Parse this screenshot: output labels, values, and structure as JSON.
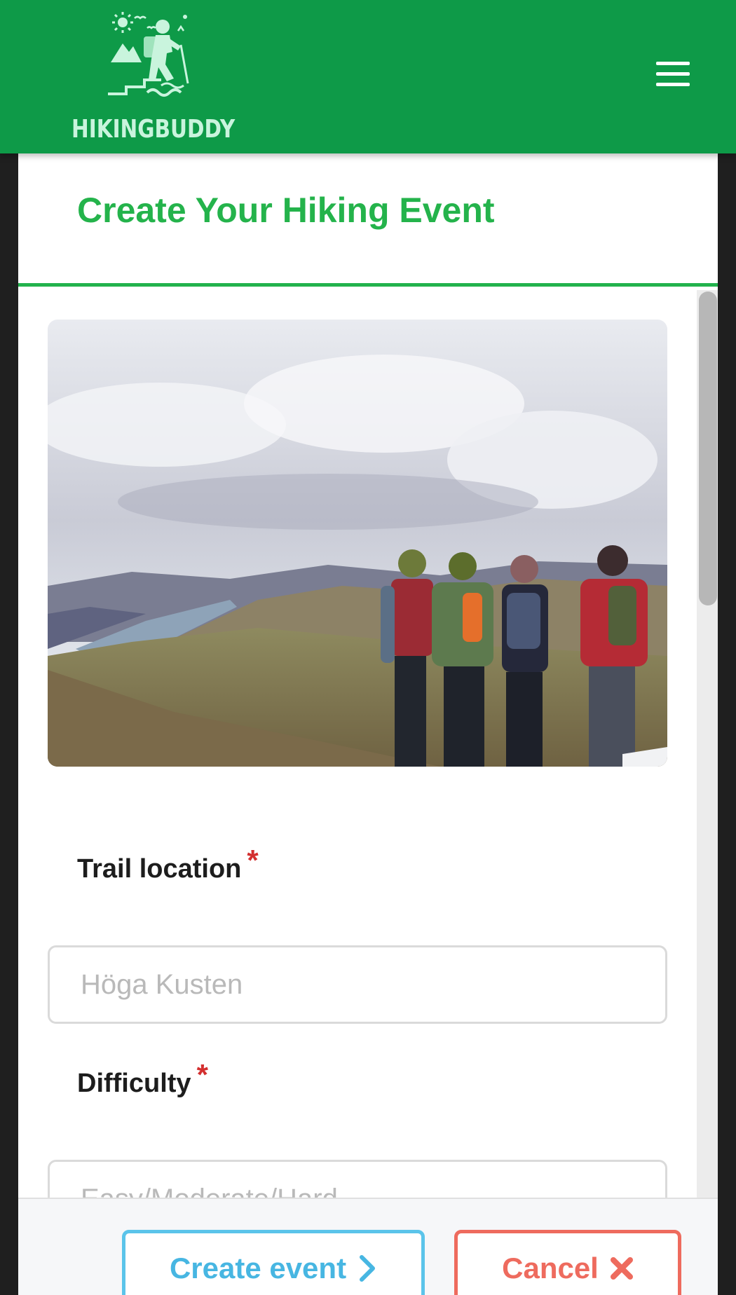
{
  "header": {
    "logo_text": "HIKINGBUDDY",
    "logo_icon": "hiker-sun-mountain-icon",
    "menu_icon": "hamburger-menu-icon",
    "background_color": "#0e9a48"
  },
  "modal": {
    "title": "Create Your Hiking Event",
    "title_color": "#24b34b",
    "hero_image": "group-of-hikers-overlooking-valley-and-lake"
  },
  "form": {
    "fields": [
      {
        "label": "Trail location",
        "required_mark": "*",
        "placeholder": "Höga Kusten",
        "value": ""
      },
      {
        "label": "Difficulty",
        "required_mark": "*",
        "placeholder": "Easy/Moderate/Hard",
        "value": ""
      }
    ]
  },
  "footer": {
    "create_label": "Create event",
    "create_icon": "chevron-right-icon",
    "create_color": "#47b6e2",
    "cancel_label": "Cancel",
    "cancel_icon": "close-x-icon",
    "cancel_color": "#ee6b5e"
  }
}
